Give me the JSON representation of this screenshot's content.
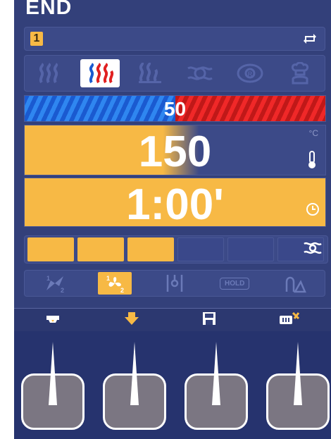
{
  "screen": {
    "title": "END"
  },
  "program": {
    "number": "1",
    "loop_icon": "loop-icon"
  },
  "modes": [
    {
      "name": "convection-mode-icon",
      "active": false
    },
    {
      "name": "combi-mode-icon",
      "active": true
    },
    {
      "name": "steam-mode-icon",
      "active": false
    },
    {
      "name": "humidity-mode-icon",
      "active": false
    },
    {
      "name": "regeneration-mode-icon",
      "active": false
    },
    {
      "name": "chef-mode-icon",
      "active": false
    }
  ],
  "humidity_bar": {
    "value": "50",
    "fraction": 0.5,
    "left_color": "#2f86f0",
    "right_color": "#e02020"
  },
  "temperature": {
    "value": "150",
    "unit": "°C",
    "icon": "thermometer-icon"
  },
  "timer": {
    "value": "1:00'",
    "icon": "clock-icon"
  },
  "phases": {
    "filled": 3,
    "total": 6,
    "icon": "steam-icon"
  },
  "fan_controls": [
    {
      "name": "fan-half-speed-icon",
      "active": false
    },
    {
      "name": "fan-speed-icon",
      "active": true
    },
    {
      "name": "probe-icon",
      "active": false
    },
    {
      "name": "hold-label",
      "label": "HOLD",
      "active": false
    },
    {
      "name": "cooking-mode-icon",
      "active": false
    }
  ],
  "soft_keys": [
    {
      "name": "tray-icon"
    },
    {
      "name": "download-arrow-icon"
    },
    {
      "name": "save-icon"
    },
    {
      "name": "service-icon"
    }
  ],
  "colors": {
    "accent": "#f7b945",
    "background": "#33407a",
    "panel": "#3c4a88"
  }
}
